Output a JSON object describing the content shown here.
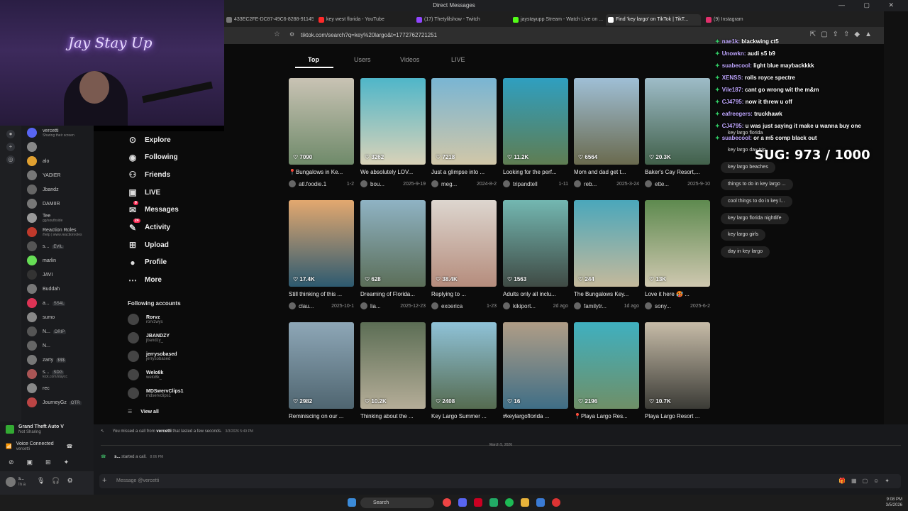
{
  "window": {
    "title": "Direct Messages"
  },
  "webcam": {
    "neon_sign": "Jay Stay Up"
  },
  "browser": {
    "tabs": [
      {
        "label": "433EC2FE-DC87-49C6-8288-911453...",
        "color": "#777"
      },
      {
        "label": "key west florida - YouTube",
        "color": "#ff2a2a"
      },
      {
        "label": "(17) Thetylilshow - Twitch",
        "color": "#9146ff"
      },
      {
        "label": "jaystayupp Stream - Watch Live on ...",
        "color": "#53fc18"
      },
      {
        "label": "Find 'key largo' on TikTok | TikT...",
        "color": "#ffffff"
      },
      {
        "label": "(9) Instagram",
        "color": "#e1306c"
      }
    ],
    "url": "tiktok.com/search?q=key%20largo&t=1772762721251"
  },
  "tiktok": {
    "nav": [
      {
        "label": "Explore",
        "icon": "compass-icon",
        "glyph": "⊙"
      },
      {
        "label": "Following",
        "icon": "following-icon",
        "glyph": "◉"
      },
      {
        "label": "Friends",
        "icon": "friends-icon",
        "glyph": "⚇"
      },
      {
        "label": "LIVE",
        "icon": "live-icon",
        "glyph": "▣"
      },
      {
        "label": "Messages",
        "icon": "messages-icon",
        "glyph": "✉",
        "badge": "9"
      },
      {
        "label": "Activity",
        "icon": "activity-icon",
        "glyph": "✎",
        "badge": "24"
      },
      {
        "label": "Upload",
        "icon": "upload-icon",
        "glyph": "⊞"
      },
      {
        "label": "Profile",
        "icon": "profile-icon",
        "glyph": "●"
      },
      {
        "label": "More",
        "icon": "more-icon",
        "glyph": "⋯"
      }
    ],
    "following_header": "Following accounts",
    "accounts": [
      {
        "name": "Rorvz",
        "handle": "rorvzwys"
      },
      {
        "name": "JBANDZY",
        "handle": "jbandzy_"
      },
      {
        "name": "jerrysobased",
        "handle": "jerrysobased"
      },
      {
        "name": "Welo8k",
        "handle": "welo8k_"
      },
      {
        "name": "MDSwervClips1",
        "handle": "mdservclips1"
      }
    ],
    "view_all": "View all",
    "search_tabs": [
      "Top",
      "Users",
      "Videos",
      "LIVE"
    ],
    "videos": [
      {
        "likes": "7090",
        "caption": "📍Bungalows in Ke...",
        "user": "atl.foodie.1",
        "date": "1-2",
        "c1": "#c9c3b4",
        "c2": "#6f8a6a"
      },
      {
        "likes": "3262",
        "caption": "We absolutely LOV...",
        "user": "bou...",
        "date": "2025-9-19",
        "c1": "#4fb6c9",
        "c2": "#d9d2b8"
      },
      {
        "likes": "7218",
        "caption": "Just a glimpse into ...",
        "user": "meg...",
        "date": "2024-8-2",
        "c1": "#79b5d3",
        "c2": "#d1c7a8"
      },
      {
        "likes": "11.2K",
        "caption": "Looking for the perf...",
        "user": "tripandtell",
        "date": "1-11",
        "c1": "#2f9fc0",
        "c2": "#5f7d52"
      },
      {
        "likes": "6564",
        "caption": "Mom and dad get t...",
        "user": "reb...",
        "date": "2025-3-24",
        "c1": "#9fbfd6",
        "c2": "#6a6a4e"
      },
      {
        "likes": "20.3K",
        "caption": "Baker's Cay Resort,...",
        "user": "ette...",
        "date": "2025-9-10",
        "c1": "#9ebcc8",
        "c2": "#41604a"
      },
      {
        "likes": "17.4K",
        "caption": "Still thinking of this ...",
        "user": "clau...",
        "date": "2025-10-1",
        "c1": "#e3a86f",
        "c2": "#2d5a70"
      },
      {
        "likes": "628",
        "caption": "Dreaming of Florida...",
        "user": "lia...",
        "date": "2025-12-23",
        "c1": "#8fb3c4",
        "c2": "#5b6e58"
      },
      {
        "likes": "38.4K",
        "caption": "Replying to ...",
        "user": "exoerica",
        "date": "1-23",
        "c1": "#ddd6cf",
        "c2": "#b58c7c"
      },
      {
        "likes": "1563",
        "caption": "Adults only all inclu...",
        "user": "kikiport...",
        "date": "2d ago",
        "c1": "#73b7b1",
        "c2": "#3f4a44"
      },
      {
        "likes": "244",
        "caption": "The Bungalows Key...",
        "user": "familytr...",
        "date": "1d ago",
        "c1": "#4aa7bb",
        "c2": "#c4b99b"
      },
      {
        "likes": "13K",
        "caption": "Love it here 🥵 ...",
        "user": "sony...",
        "date": "2025-6-2",
        "c1": "#5e8a4f",
        "c2": "#cfc8b0"
      },
      {
        "likes": "2982",
        "caption": "Reminiscing on our ...",
        "user": "",
        "date": "",
        "c1": "#8ea7b7",
        "c2": "#4f6570"
      },
      {
        "likes": "10.2K",
        "caption": "Thinking about the ...",
        "user": "",
        "date": "",
        "c1": "#5c6e55",
        "c2": "#b5ad98"
      },
      {
        "likes": "2408",
        "caption": "Key Largo Summer ...",
        "user": "",
        "date": "",
        "c1": "#8fc2d8",
        "c2": "#556b50"
      },
      {
        "likes": "16",
        "caption": "#keylargoflorida ...",
        "user": "",
        "date": "",
        "c1": "#b09d86",
        "c2": "#3f6e86"
      },
      {
        "likes": "2196",
        "caption": "📍Playa Largo Res...",
        "user": "",
        "date": "",
        "c1": "#3fb0c0",
        "c2": "#6f8f67"
      },
      {
        "likes": "10.7K",
        "caption": "Playa Largo Resort ...",
        "user": "",
        "date": "",
        "c1": "#c7bca8",
        "c2": "#3b3b36"
      }
    ],
    "suggestions": [
      "key largo florida",
      "key largo day trip",
      "key largo beaches",
      "things to do in key largo ...",
      "cool things to do in key l...",
      "key largo florida nightlife",
      "key largo girls",
      "day in key largo"
    ]
  },
  "stream_chat": [
    {
      "user": "nae1k:",
      "msg": "blackwing ct5"
    },
    {
      "user": "Unowkn:",
      "msg": "audi s5 b9"
    },
    {
      "user": "suabecool:",
      "msg": "light blue maybackkkk"
    },
    {
      "user": "XENSS:",
      "msg": "rolls royce spectre"
    },
    {
      "user": "Vile187:",
      "msg": "cant go wrong wit the m&m"
    },
    {
      "user": "CJ4795:",
      "msg": "now it threw u off"
    },
    {
      "user": "eafreegers:",
      "msg": "truckhawk"
    },
    {
      "user": "CJ4795:",
      "msg": "u was just saying it make u wanna buy one"
    },
    {
      "user": "suabecool:",
      "msg": "or a m5 comp black out"
    }
  ],
  "sug_counter": "SUG:  973 / 1000",
  "discord": {
    "members": [
      {
        "name": "vercetti",
        "sub": "Sharing their screen",
        "color": "#5865f2"
      },
      {
        "name": "",
        "sub": "",
        "color": "#888"
      },
      {
        "name": "alo",
        "sub": "",
        "color": "#e0a030"
      },
      {
        "name": "YADIER",
        "sub": "",
        "color": "#777"
      },
      {
        "name": "Jbandz",
        "sub": "",
        "color": "#666"
      },
      {
        "name": "DAMIIR",
        "sub": "",
        "color": "#777"
      },
      {
        "name": "Tee",
        "sub": "gg/southside",
        "color": "#999"
      },
      {
        "name": "Reaction Roles",
        "sub": "/help | www.reactionroles",
        "color": "#c0392b"
      },
      {
        "name": "s...",
        "sub": "",
        "tag": "EVIL",
        "color": "#555"
      },
      {
        "name": "marlin",
        "sub": "",
        "color": "#6d5"
      },
      {
        "name": "JAVI",
        "sub": "",
        "color": "#333"
      },
      {
        "name": "Buddah",
        "sub": "",
        "color": "#777"
      },
      {
        "name": "a...",
        "sub": "",
        "tag": "SS4L",
        "color": "#d35"
      },
      {
        "name": "sumo",
        "sub": "",
        "color": "#888"
      },
      {
        "name": "N...",
        "sub": "",
        "tag": "DRIP",
        "color": "#555"
      },
      {
        "name": "N...",
        "sub": "",
        "color": "#666"
      },
      {
        "name": "zarty",
        "sub": "",
        "tag": "$$$",
        "color": "#777"
      },
      {
        "name": "s...",
        "sub": "kick.com/staycc",
        "tag": "SDG",
        "color": "#a55"
      },
      {
        "name": "rec",
        "sub": "",
        "color": "#888"
      },
      {
        "name": "JourneyGz",
        "sub": "",
        "tag": "OTR",
        "color": "#b44"
      }
    ],
    "game": {
      "title": "Grand Theft Auto V",
      "status": "Not Sharing"
    },
    "voice": {
      "title": "Voice Connected",
      "sub": "vercetti"
    },
    "user": {
      "name": "s...",
      "status": "In a"
    },
    "messages": [
      {
        "text_pre": "You missed a call from ",
        "bold": "vercetti",
        "text_post": " that lasted a few seconds.",
        "time": "3/3/2026 5:49 PM"
      },
      {
        "divider": "March 5, 2026"
      },
      {
        "text_pre": "",
        "bold": "s...",
        "text_post": " started a call.",
        "time": "8:06 PM"
      }
    ],
    "placeholder": "Message @vercetti"
  },
  "taskbar": {
    "search": "Search",
    "time": "9:08 PM",
    "date": "3/5/2026"
  }
}
